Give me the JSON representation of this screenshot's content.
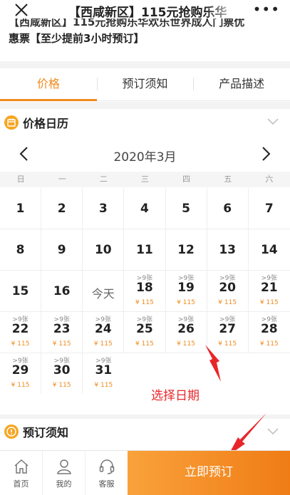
{
  "header": {
    "title": "【西咸新区】115元抢购乐华",
    "more": "•••"
  },
  "product": {
    "line1": "【西咸新区】115元抢购乐华欢乐世界成人门票优",
    "line2": "惠票【至少提前3小时预订】"
  },
  "tabs": [
    {
      "label": "价格"
    },
    {
      "label": "预订须知"
    },
    {
      "label": "产品描述"
    }
  ],
  "price_calendar": {
    "title": "价格日历",
    "month": "2020年3月"
  },
  "weekdays": [
    "日",
    "一",
    "二",
    "三",
    "四",
    "五",
    "六"
  ],
  "calendar": [
    [
      {
        "day": "1"
      },
      {
        "day": "2"
      },
      {
        "day": "3"
      },
      {
        "day": "4"
      },
      {
        "day": "5"
      },
      {
        "day": "6"
      },
      {
        "day": "7"
      }
    ],
    [
      {
        "day": "8"
      },
      {
        "day": "9"
      },
      {
        "day": "10"
      },
      {
        "day": "11"
      },
      {
        "day": "12"
      },
      {
        "day": "13"
      },
      {
        "day": "14"
      }
    ],
    [
      {
        "day": "15"
      },
      {
        "day": "16"
      },
      {
        "today": "今天"
      },
      {
        "day": "18",
        "stock": ">9张",
        "price": "¥ 115"
      },
      {
        "day": "19",
        "stock": ">9张",
        "price": "¥ 115"
      },
      {
        "day": "20",
        "stock": ">9张",
        "price": "¥ 115"
      },
      {
        "day": "21",
        "stock": ">9张",
        "price": "¥ 115"
      }
    ],
    [
      {
        "day": "22",
        "stock": ">9张",
        "price": "¥ 115"
      },
      {
        "day": "23",
        "stock": ">9张",
        "price": "¥ 115"
      },
      {
        "day": "24",
        "stock": ">9张",
        "price": "¥ 115"
      },
      {
        "day": "25",
        "stock": ">9张",
        "price": "¥ 115"
      },
      {
        "day": "26",
        "stock": ">9张",
        "price": "¥ 115"
      },
      {
        "day": "27",
        "stock": ">9张",
        "price": "¥ 115"
      },
      {
        "day": "28",
        "stock": ">9张",
        "price": "¥ 115"
      }
    ],
    [
      {
        "day": "29",
        "stock": ">9张",
        "price": "¥ 115"
      },
      {
        "day": "30",
        "stock": ">9张",
        "price": "¥ 115"
      },
      {
        "day": "31",
        "stock": ">9张",
        "price": "¥ 115"
      }
    ]
  ],
  "annotation": "选择日期",
  "booking_notes": {
    "title": "预订须知"
  },
  "bottom_nav": [
    {
      "label": "首页"
    },
    {
      "label": "我的"
    },
    {
      "label": "客服"
    }
  ],
  "book_button": "立即预订",
  "colors": {
    "accent": "#f08a1c",
    "annotation": "#e8262a"
  }
}
